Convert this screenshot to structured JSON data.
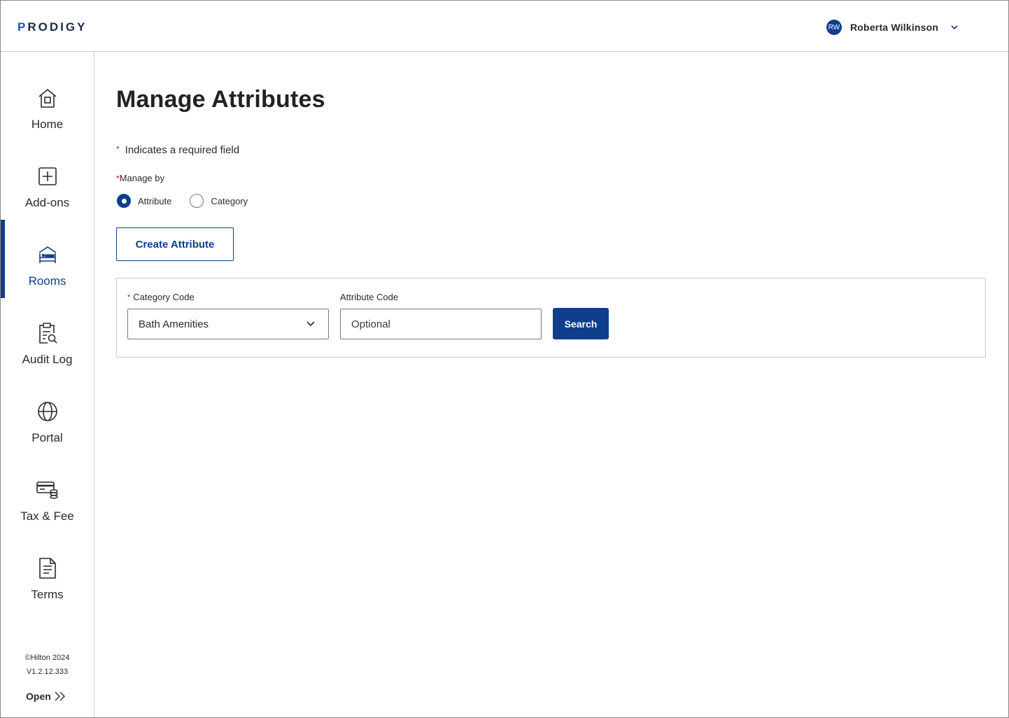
{
  "app": {
    "logo_first": "P",
    "logo_rest": "RODIGY"
  },
  "user": {
    "initials": "RW",
    "name": "Roberta Wilkinson"
  },
  "sidebar": {
    "items": [
      {
        "label": "Home",
        "icon": "home-icon"
      },
      {
        "label": "Add-ons",
        "icon": "plus-square-icon"
      },
      {
        "label": "Rooms",
        "icon": "bed-icon",
        "active": true
      },
      {
        "label": "Audit Log",
        "icon": "clipboard-search-icon"
      },
      {
        "label": "Portal",
        "icon": "globe-icon"
      },
      {
        "label": "Tax & Fee",
        "icon": "card-coins-icon"
      },
      {
        "label": "Terms",
        "icon": "document-icon"
      }
    ],
    "copyright": "©Hilton 2024",
    "version": "V1.2.12.333",
    "open_label": "Open"
  },
  "main": {
    "title": "Manage Attributes",
    "required_star": "*",
    "required_note": "Indicates a required field",
    "manage_by_label": "Manage by",
    "radios": [
      {
        "label": "Attribute",
        "checked": true
      },
      {
        "label": "Category",
        "checked": false
      }
    ],
    "create_button": "Create Attribute",
    "filters": {
      "category_label": "Category Code",
      "category_value": "Bath Amenities",
      "attribute_label": "Attribute Code",
      "attribute_placeholder": "Optional",
      "search_button": "Search"
    }
  },
  "colors": {
    "brand": "#0f3e8c",
    "required": "#d0103a"
  }
}
